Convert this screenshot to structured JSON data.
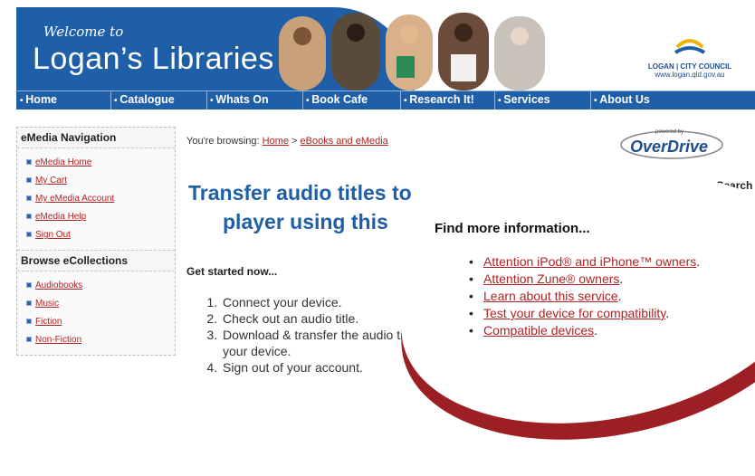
{
  "header": {
    "welcome": "Welcome to",
    "title": "Logan’s Libraries",
    "logo_text": "LOGAN | CITY COUNCIL",
    "logo_url": "www.logan.qld.gov.au"
  },
  "nav": {
    "items": [
      "Home",
      "Catalogue",
      "Whats On",
      "Book Cafe",
      "Research It!",
      "Services",
      "About Us"
    ]
  },
  "sidebar": {
    "emedia_heading": "eMedia Navigation",
    "emedia_items": [
      "eMedia Home",
      "My Cart",
      "My eMedia Account",
      "eMedia Help",
      "Sign Out"
    ],
    "collections_heading": "Browse eCollections",
    "collections_items": [
      "Audiobooks",
      "Music",
      "Fiction",
      "Non-Fiction"
    ]
  },
  "main": {
    "breadcrumb_prefix": "You're browsing:",
    "breadcrumb_home": "Home",
    "breadcrumb_sep": ">",
    "breadcrumb_current": "eBooks and eMedia",
    "overdrive_small": "powered by",
    "overdrive_word": "OverDrive",
    "heading_line1": "Transfer audio titles to",
    "heading_line2": "player using this",
    "catalogue_search": "Catalogue Search",
    "get_started": "Get started now...",
    "steps": [
      "Connect your device.",
      "Check out an audio title.",
      "Download & transfer the audio title to your device.",
      "Sign out of your account."
    ]
  },
  "popup": {
    "title": "Find more information...",
    "links": [
      "Attention iPod® and iPhone™ owners",
      "Attention Zune® owners",
      "Learn about this service",
      "Test your device for compatibility",
      "Compatible devices"
    ],
    "suffix": "."
  },
  "colors": {
    "brand_blue": "#1e5fa8",
    "link_red": "#b22222",
    "popup_shadow": "#9c1f24"
  }
}
